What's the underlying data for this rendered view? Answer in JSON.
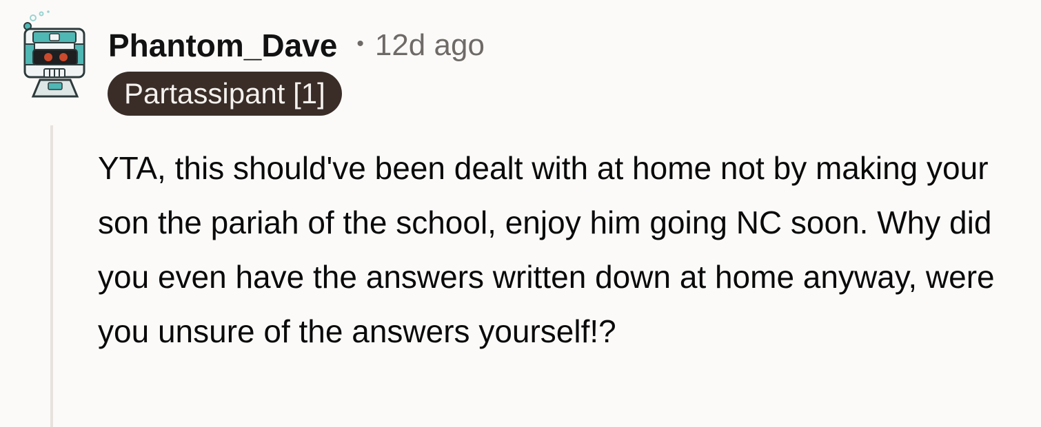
{
  "comment": {
    "author": {
      "username": "Phantom_Dave",
      "avatar_icon": "robot-avatar-icon"
    },
    "separator": "•",
    "timestamp": "12d ago",
    "flair": "Partassipant [1]",
    "body": "YTA, this should've been dealt with at home not by making your son the pariah of the school, enjoy him going NC soon. Why did you even have the answers written down at home anyway, were you unsure of the answers yourself!?"
  },
  "colors": {
    "background": "#fbfaf9",
    "flair_background": "#3a2d27",
    "flair_text": "#f4f1ee",
    "meta_text": "#6e6a67",
    "thread_line": "#e7e2dd",
    "avatar_teal": "#4fb7b4"
  }
}
